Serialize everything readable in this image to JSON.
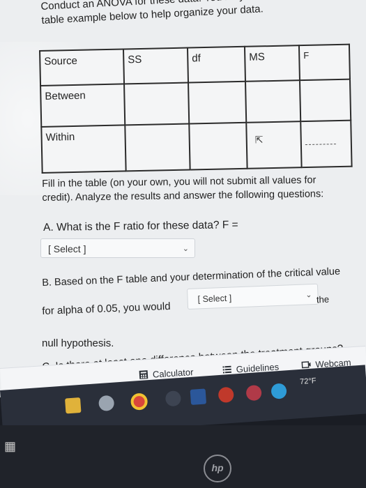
{
  "intro": {
    "line1": "Conduct an ANOVA for these data. You may use the summary",
    "line2": "table example below to help organize your data."
  },
  "table": {
    "headers": [
      "Source",
      "SS",
      "df",
      "MS",
      "F"
    ],
    "rows": [
      {
        "label": "Between"
      },
      {
        "label": "Within"
      }
    ]
  },
  "instructions": {
    "line1": "Fill in the table (on your own, you will not submit all values for",
    "line2": "credit). Analyze the results and answer the following questions:"
  },
  "question_a": {
    "text": "A. What is the F ratio for these data? F =",
    "select_value": "[ Select ]"
  },
  "question_b": {
    "line1": "B. Based on the F table and your determination of the critical value",
    "line2_prefix": "for alpha of 0.05, you would",
    "select_value": "[ Select ]",
    "suffix": "the",
    "line3": "null hypothesis."
  },
  "question_c": {
    "text": "C. Is there at least one difference between the treatment groups?"
  },
  "toolbar": {
    "calculator": "Calculator",
    "guidelines": "Guidelines",
    "webcam": "Webcam"
  },
  "taskbar": {
    "temperature": "72°F",
    "logo": "hp"
  }
}
